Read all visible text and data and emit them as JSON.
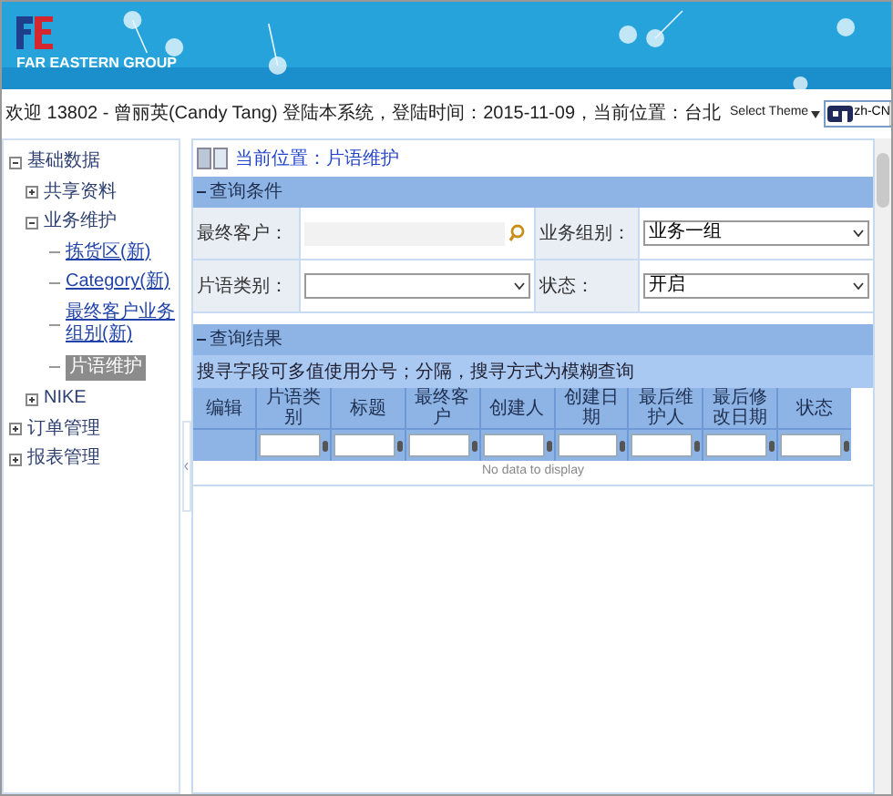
{
  "header": {
    "logo_text": "FAR EASTERN GROUP"
  },
  "info_bar": {
    "welcome": "欢迎 13802 - 曾丽英(Candy Tang) 登陆本系统，登陆时间：2015-11-09，当前位置：台北",
    "theme_label": "Select Theme",
    "language": "zh-CN"
  },
  "sidebar": {
    "items": [
      {
        "kind": "folder",
        "label": "基础数据",
        "expanded": true,
        "children": [
          {
            "kind": "folder",
            "label": "共享资料",
            "expanded": false
          },
          {
            "kind": "folder",
            "label": "业务维护",
            "expanded": true,
            "children": [
              {
                "kind": "link",
                "label": "拣货区(新)",
                "selected": false
              },
              {
                "kind": "link",
                "label": "Category(新)",
                "selected": false
              },
              {
                "kind": "link",
                "label": "最终客户业务组别(新)",
                "selected": false
              },
              {
                "kind": "link",
                "label": "片语维护",
                "selected": true
              }
            ]
          },
          {
            "kind": "folder",
            "label": "NIKE",
            "expanded": false
          }
        ]
      },
      {
        "kind": "folder",
        "label": "订单管理",
        "expanded": false
      },
      {
        "kind": "folder",
        "label": "报表管理",
        "expanded": false
      }
    ]
  },
  "main": {
    "breadcrumb": "当前位置：片语维护",
    "query": {
      "title": "查询条件",
      "fields": [
        {
          "label": "最终客户：",
          "kind": "lookup"
        },
        {
          "label": "业务组别：",
          "kind": "select",
          "value": "业务一组"
        },
        {
          "label": "片语类别：",
          "kind": "select"
        },
        {
          "label": "状态：",
          "kind": "select",
          "value": "开启"
        }
      ]
    },
    "results": {
      "title": "查询结果",
      "hint": "搜寻字段可多值使用分号；分隔，搜寻方式为模糊查询",
      "columns": [
        "编辑",
        "片语类别",
        "标题",
        "最终客户",
        "创建人",
        "创建日期",
        "最后维护人",
        "最后修改日期",
        "状态"
      ],
      "empty_text": "No data to display"
    }
  }
}
